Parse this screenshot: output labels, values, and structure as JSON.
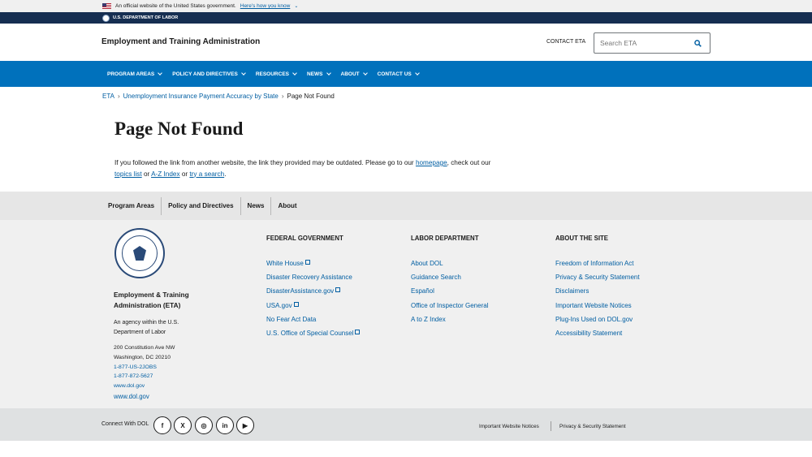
{
  "banner": {
    "text": "An official website of the United States government.",
    "how_link": "Here's how you know"
  },
  "agency_bar": {
    "text": "U.S. DEPARTMENT OF LABOR"
  },
  "header": {
    "site_title": "Employment and Training Administration",
    "contact_link": "CONTACT ETA",
    "search_placeholder": "Search ETA"
  },
  "nav": {
    "items": [
      {
        "label": "PROGRAM AREAS"
      },
      {
        "label": "POLICY AND DIRECTIVES"
      },
      {
        "label": "RESOURCES"
      },
      {
        "label": "NEWS"
      },
      {
        "label": "ABOUT"
      },
      {
        "label": "CONTACT US"
      }
    ]
  },
  "breadcrumb": {
    "items": [
      "ETA",
      "Unemployment Insurance Payment Accuracy by State",
      "Page Not Found"
    ],
    "separator": "›"
  },
  "main": {
    "title": "Page Not Found",
    "text_1": "If you followed the link from another website, the link they provided may be outdated. Please go to our ",
    "link_homepage": "homepage",
    "text_2": ", check out our ",
    "link_topics": "topics list",
    "text_3": " or ",
    "link_az": "A-Z Index",
    "text_4": " or ",
    "link_search": "try a search",
    "text_5": "."
  },
  "subnav": {
    "items": [
      "Program Areas",
      "Policy and Directives",
      "News",
      "About"
    ]
  },
  "footer": {
    "agency_name": "Employment & Training Administration (ETA)",
    "agency_desc": "An agency within the U.S. Department of Labor",
    "address_1": "200 Constitution Ave NW",
    "address_2": "Washington, DC 20210",
    "phone_1": "1-877-US-2JOBS",
    "phone_2": "1-877-872-5627",
    "site_1": "www.dol.gov",
    "site_2": "www.dol.gov",
    "columns": [
      {
        "heading": "FEDERAL GOVERNMENT",
        "links": [
          "White House",
          "Disaster Recovery Assistance",
          "DisasterAssistance.gov",
          "USA.gov",
          "No Fear Act Data",
          "U.S. Office of Special Counsel"
        ]
      },
      {
        "heading": "LABOR DEPARTMENT",
        "links": [
          "About DOL",
          "Guidance Search",
          "Español",
          "Office of Inspector General",
          "A to Z Index"
        ]
      },
      {
        "heading": "ABOUT THE SITE",
        "links": [
          "Freedom of Information Act",
          "Privacy & Security Statement",
          "Disclaimers",
          "Important Website Notices",
          "Plug-Ins Used on DOL.gov",
          "Accessibility Statement"
        ]
      }
    ]
  },
  "bottom": {
    "connect_label": "Connect With DOL",
    "social": [
      {
        "name": "facebook-icon",
        "glyph": "f"
      },
      {
        "name": "x-icon",
        "glyph": "X"
      },
      {
        "name": "instagram-icon",
        "glyph": "◎"
      },
      {
        "name": "linkedin-icon",
        "glyph": "in"
      },
      {
        "name": "youtube-icon",
        "glyph": "▶"
      }
    ],
    "link_notices": "Important Website Notices",
    "link_privacy": "Privacy & Security Statement"
  },
  "colors": {
    "nav": "#0071bc",
    "agency_bar": "#162e51",
    "link": "#005ea2"
  }
}
